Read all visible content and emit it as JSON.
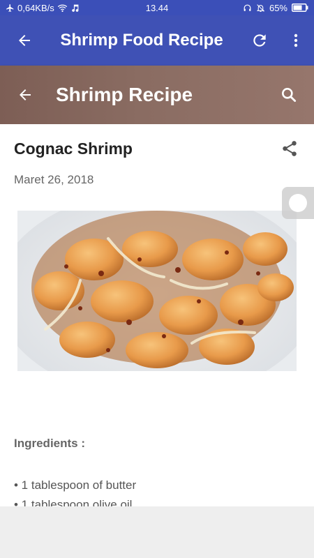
{
  "status_bar": {
    "network_speed": "0,64KB/s",
    "time": "13.44",
    "battery": "65%"
  },
  "app_bar": {
    "title": "Shrimp Food Recipe"
  },
  "blog_header": {
    "title": "Shrimp Recipe"
  },
  "post": {
    "title": "Cognac Shrimp",
    "date": "Maret 26, 2018",
    "ingredients_heading": "Ingredients :",
    "ingredients": [
      "• 1 tablespoon of butter",
      "• 1 tablespoon olive oil"
    ]
  },
  "colors": {
    "status_bar": "#3b4fb8",
    "app_bar": "#3f51b5",
    "blog_header": "#8a6c62"
  },
  "icons": {
    "back": "arrow-left-icon",
    "refresh": "refresh-icon",
    "menu": "more-vert-icon",
    "search": "search-icon",
    "share": "share-icon"
  }
}
